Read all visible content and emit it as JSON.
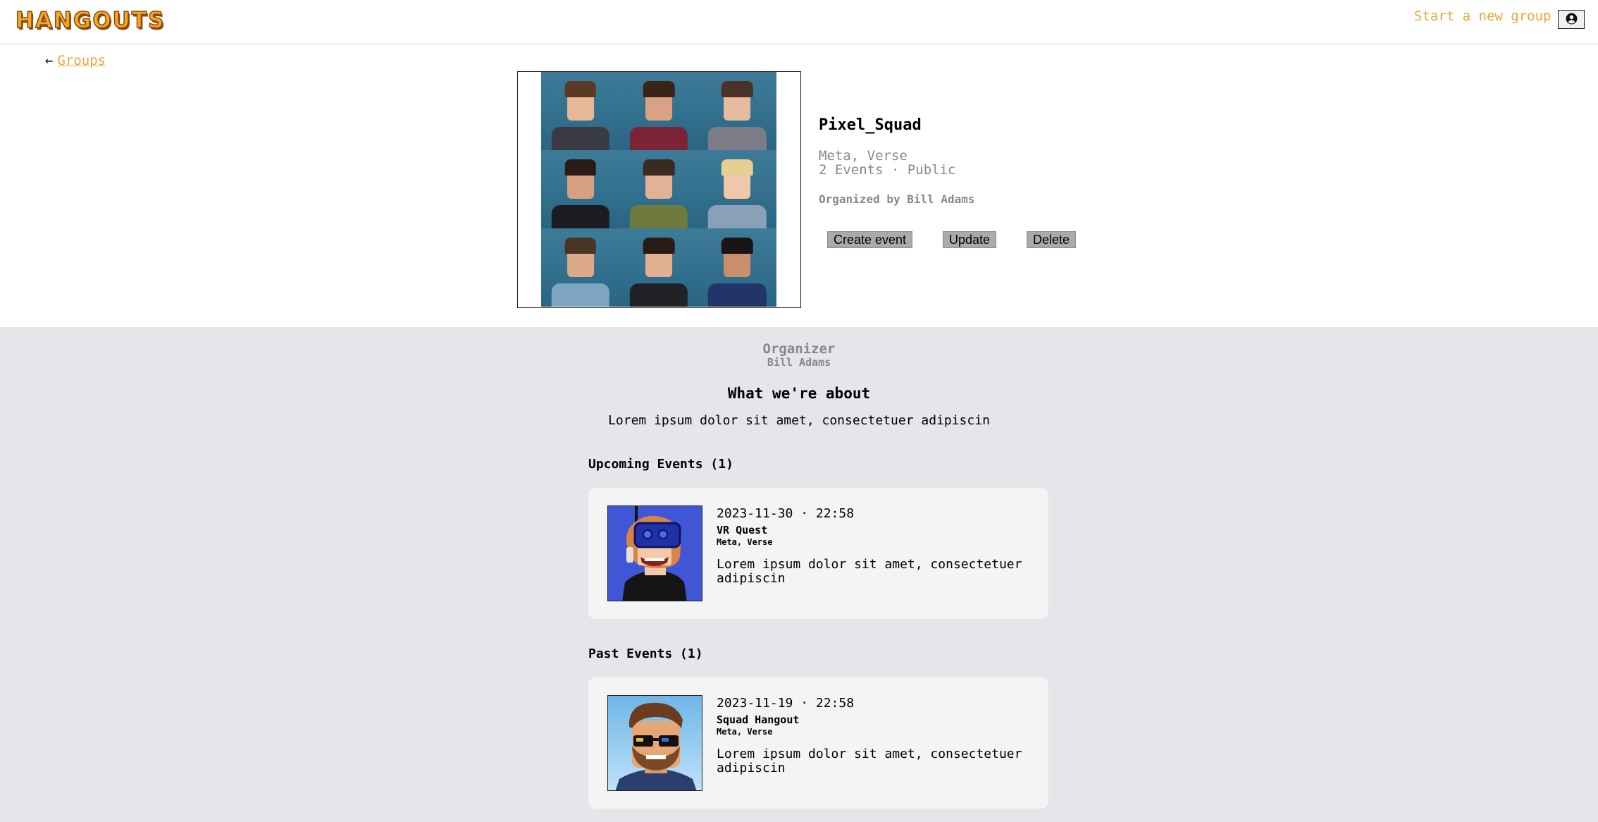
{
  "nav": {
    "logo": "HANGOUTS",
    "start_group": "Start a new group",
    "profile_icon": "user-circle-icon"
  },
  "breadcrumb": {
    "arrow": "←",
    "groups_label": "Groups"
  },
  "group": {
    "name": "Pixel_Squad",
    "location": "Meta, Verse",
    "meta": "2 Events · Public",
    "organized_by": "Organized by Bill Adams",
    "image_icon": "group-avatars-image"
  },
  "actions": {
    "create_event": "Create event",
    "update": "Update",
    "delete": "Delete"
  },
  "organizer": {
    "label": "Organizer",
    "name": "Bill Adams"
  },
  "about": {
    "title": "What we're about",
    "text": "Lorem ipsum dolor sit amet, consectetuer adipiscin"
  },
  "upcoming": {
    "title": "Upcoming Events (1)",
    "events": [
      {
        "date": "2023-11-30 · 22:58",
        "name": "VR Quest",
        "location": "Meta, Verse",
        "description": "Lorem ipsum dolor sit amet, consectetuer adipiscin",
        "image_icon": "vr-headset-avatar-image"
      }
    ]
  },
  "past": {
    "title": "Past Events (1)",
    "events": [
      {
        "date": "2023-11-19 · 22:58",
        "name": "Squad Hangout",
        "location": "Meta, Verse",
        "description": "Lorem ipsum dolor sit amet, consectetuer adipiscin",
        "image_icon": "sunglasses-avatar-image"
      }
    ]
  },
  "colors": {
    "accent": "#e8a73a",
    "muted": "#8b8493",
    "section_bg": "#e6e5ea",
    "card_bg": "#f4f4f4",
    "button_bg": "#aaaaaa"
  }
}
